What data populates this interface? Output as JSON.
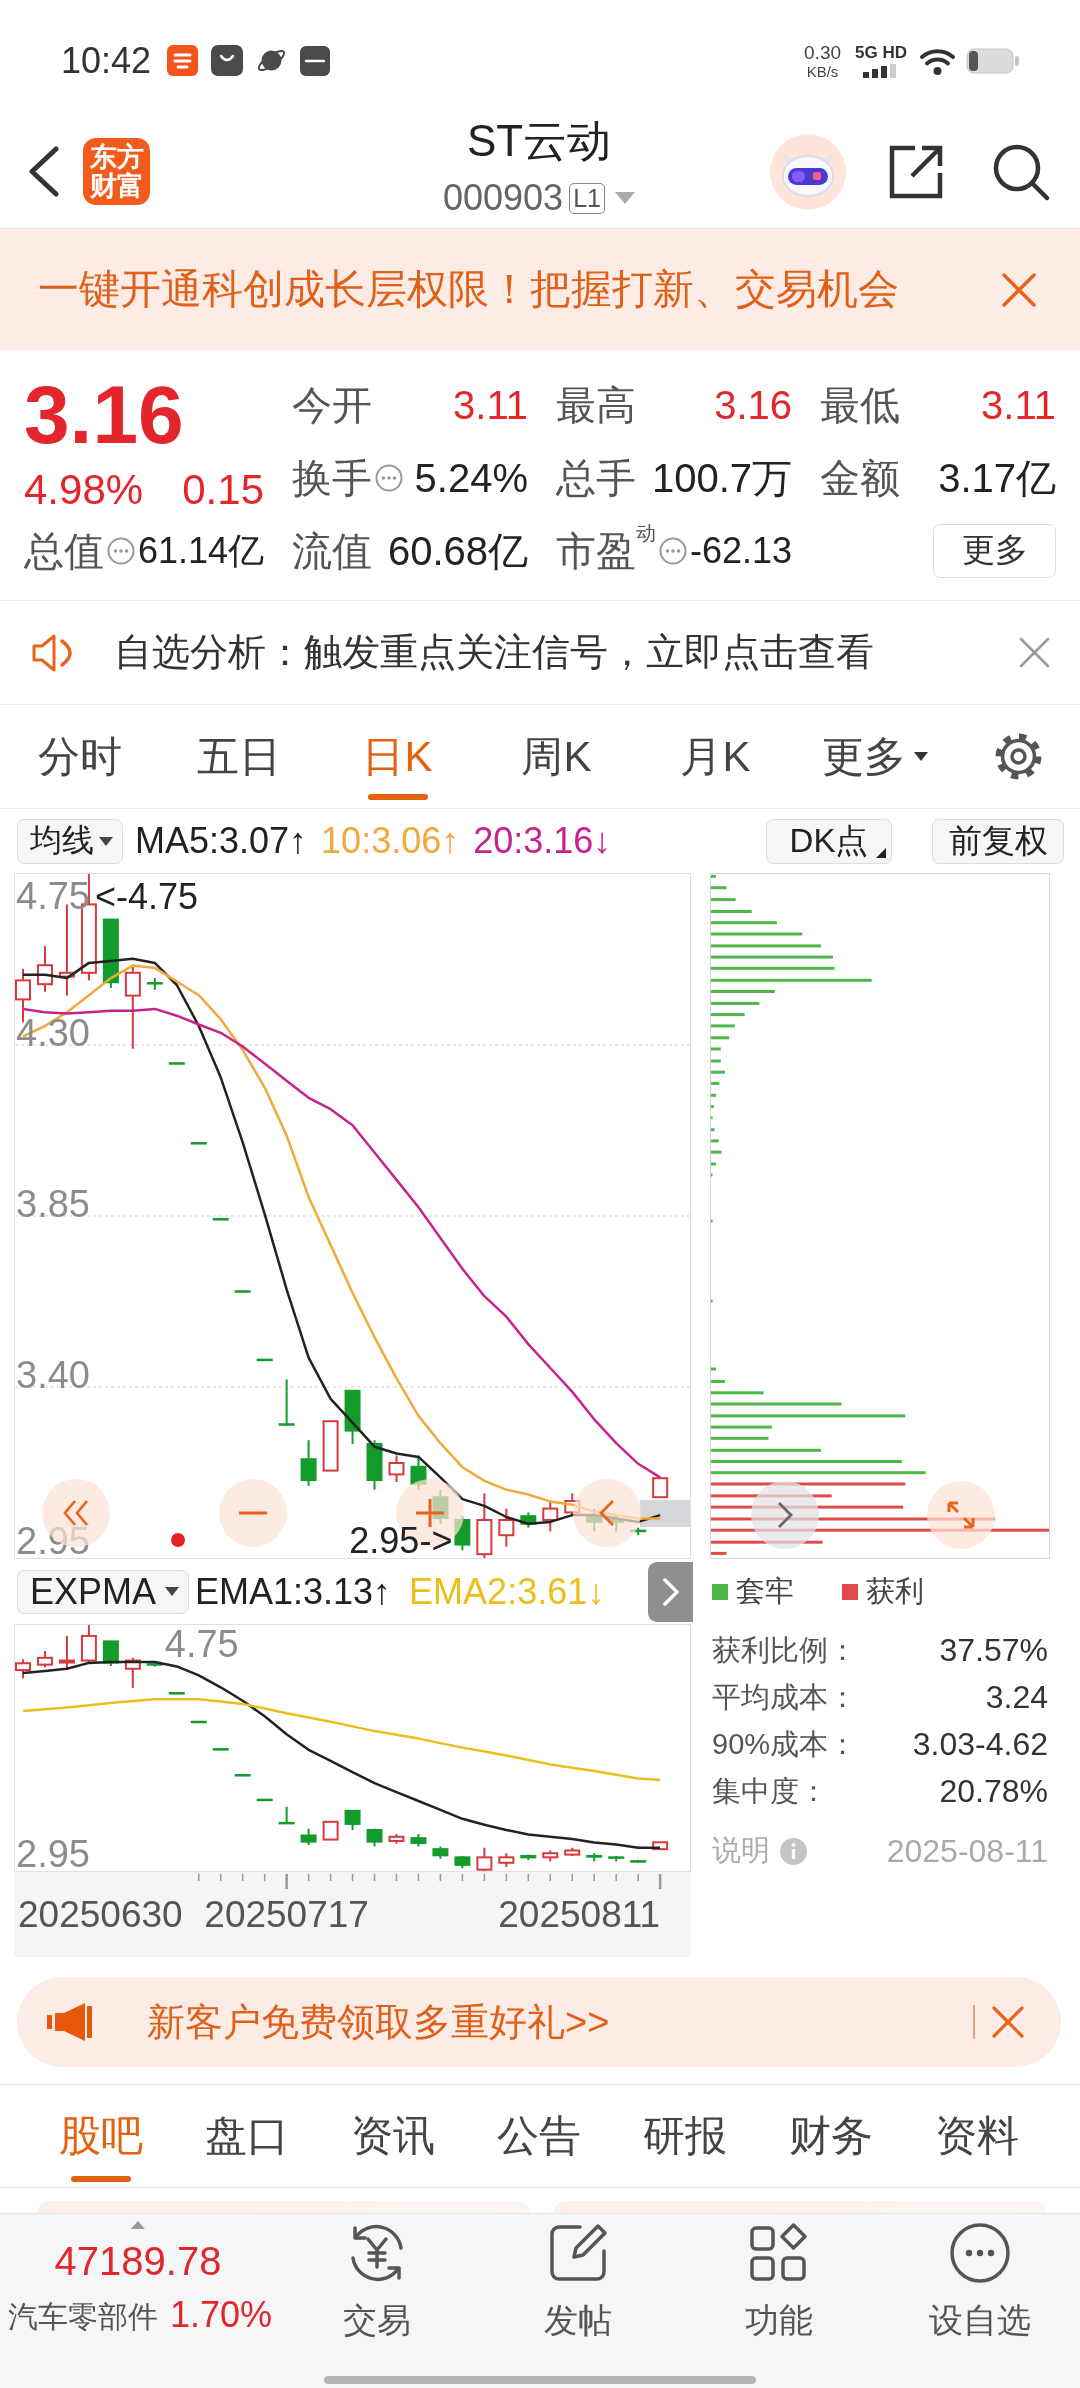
{
  "status_bar": {
    "time": "10:42",
    "speed_value": "0.30",
    "speed_unit": "KB/s",
    "network": "5G HD"
  },
  "header": {
    "logo": "东方财富",
    "title": "ST云动",
    "code": "000903",
    "badge": "L1"
  },
  "banner": {
    "text": "一键开通科创成长层权限！把握打新、交易机会"
  },
  "quote": {
    "price": "3.16",
    "change_percent": "4.98%",
    "change": "0.15",
    "rising": true,
    "total_value": {
      "label": "总值",
      "value": "61.14亿",
      "info": true
    },
    "fields": [
      {
        "label": "今开",
        "value": "3.11",
        "rising": true,
        "info": false
      },
      {
        "label": "最高",
        "value": "3.16",
        "rising": true,
        "info": false
      },
      {
        "label": "最低",
        "value": "3.11",
        "rising": true,
        "info": false
      },
      {
        "label": "换手",
        "value": "5.24%",
        "rising": false,
        "info": true
      },
      {
        "label": "总手",
        "value": "100.7万",
        "rising": false,
        "info": false
      },
      {
        "label": "金额",
        "value": "3.17亿",
        "rising": false,
        "info": false
      },
      {
        "label": "流值",
        "value": "60.68亿",
        "rising": false,
        "info": false
      },
      {
        "label": "市盈$^{动}$",
        "value": "-62.13",
        "rising": false,
        "info": true
      }
    ],
    "more_button": "更多"
  },
  "notice": {
    "text": "自选分析：触发重点关注信号，立即点击查看"
  },
  "period_tabs": [
    {
      "label": "分时",
      "selected": false
    },
    {
      "label": "五日",
      "selected": false
    },
    {
      "label": "日K",
      "selected": true
    },
    {
      "label": "周K",
      "selected": false
    },
    {
      "label": "月K",
      "selected": false
    }
  ],
  "period_more": "更多",
  "ma_bar": {
    "selector": "均线",
    "indicators": [
      {
        "label": "MA5:3.07↑",
        "color": "#222222"
      },
      {
        "label": "10:3.06↑",
        "color": "#f2a93b"
      },
      {
        "label": "20:3.16↓",
        "color": "#c8238c"
      }
    ],
    "dk_button": "DK点",
    "adjust_button": "前复权"
  },
  "main_chart": {
    "y_labels": [
      "4.75",
      "4.30",
      "3.85",
      "3.40",
      "2.95"
    ],
    "high_marker": "<-4.75",
    "low_marker": "2.95->"
  },
  "chips": {
    "legend": [
      {
        "label": "套牢",
        "color": "#4db848"
      },
      {
        "label": "获利",
        "color": "#e04a4a"
      }
    ],
    "stats": [
      {
        "label": "获利比例：",
        "value": "37.57%"
      },
      {
        "label": "平均成本：",
        "value": "3.24"
      },
      {
        "label": "90%成本：",
        "value": "3.03-4.62"
      },
      {
        "label": "集中度：",
        "value": "20.78%"
      }
    ],
    "note_label": "说明",
    "date": "2025-08-11"
  },
  "expma": {
    "selector": "EXPMA",
    "indicators": [
      {
        "label": "EMA1:3.13↑",
        "color": "#222222"
      },
      {
        "label": "EMA2:3.61↓",
        "color": "#ecbe1c"
      }
    ],
    "y_labels": [
      "4.75",
      "2.95"
    ],
    "dates": [
      "20250630",
      "20250717",
      "20250811"
    ]
  },
  "promo": {
    "text": "新客户免费领取多重好礼>>"
  },
  "section_tabs": [
    {
      "label": "股吧",
      "selected": true
    },
    {
      "label": "盘口",
      "selected": false
    },
    {
      "label": "资讯",
      "selected": false
    },
    {
      "label": "公告",
      "selected": false
    },
    {
      "label": "研报",
      "selected": false
    },
    {
      "label": "财务",
      "selected": false
    },
    {
      "label": "资料",
      "selected": false
    }
  ],
  "bottom_bar": {
    "index_value": "47189.78",
    "sector": "汽车零部件",
    "sector_change": "1.70%",
    "rising": true,
    "actions": [
      {
        "label": "交易",
        "kind": "trade"
      },
      {
        "label": "发帖",
        "kind": "post"
      },
      {
        "label": "功能",
        "kind": "apps"
      },
      {
        "label": "设自选",
        "kind": "watch"
      }
    ]
  }
}
